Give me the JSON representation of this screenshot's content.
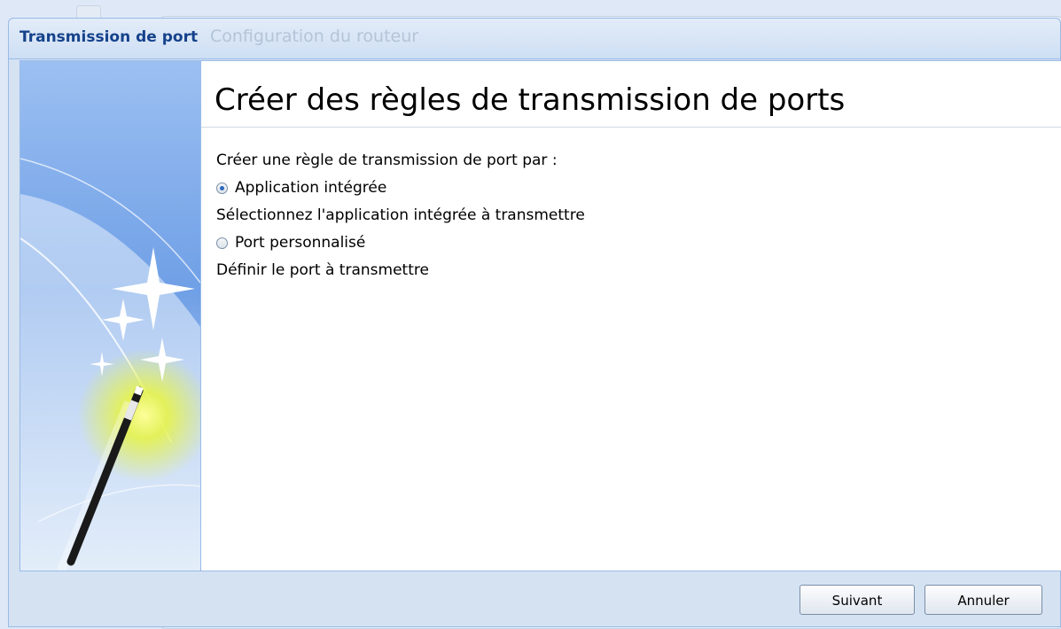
{
  "window": {
    "title": "Transmission de port",
    "background_title": "Configuration du routeur"
  },
  "wizard": {
    "heading": "Créer des règles de transmission de ports",
    "prompt": "Créer une règle de transmission de port par :",
    "options": [
      {
        "label": "Application intégrée",
        "description": "Sélectionnez l'application intégrée à transmettre",
        "selected": true
      },
      {
        "label": "Port personnalisé",
        "description": "Définir le port à transmettre",
        "selected": false
      }
    ],
    "side_image_icon": "magic-wand-icon"
  },
  "buttons": {
    "next_label": "Suivant",
    "cancel_label": "Annuler"
  },
  "colors": {
    "title_text": "#15428b",
    "border": "#99bbe8",
    "radio_selected": "#2d6ac0"
  }
}
